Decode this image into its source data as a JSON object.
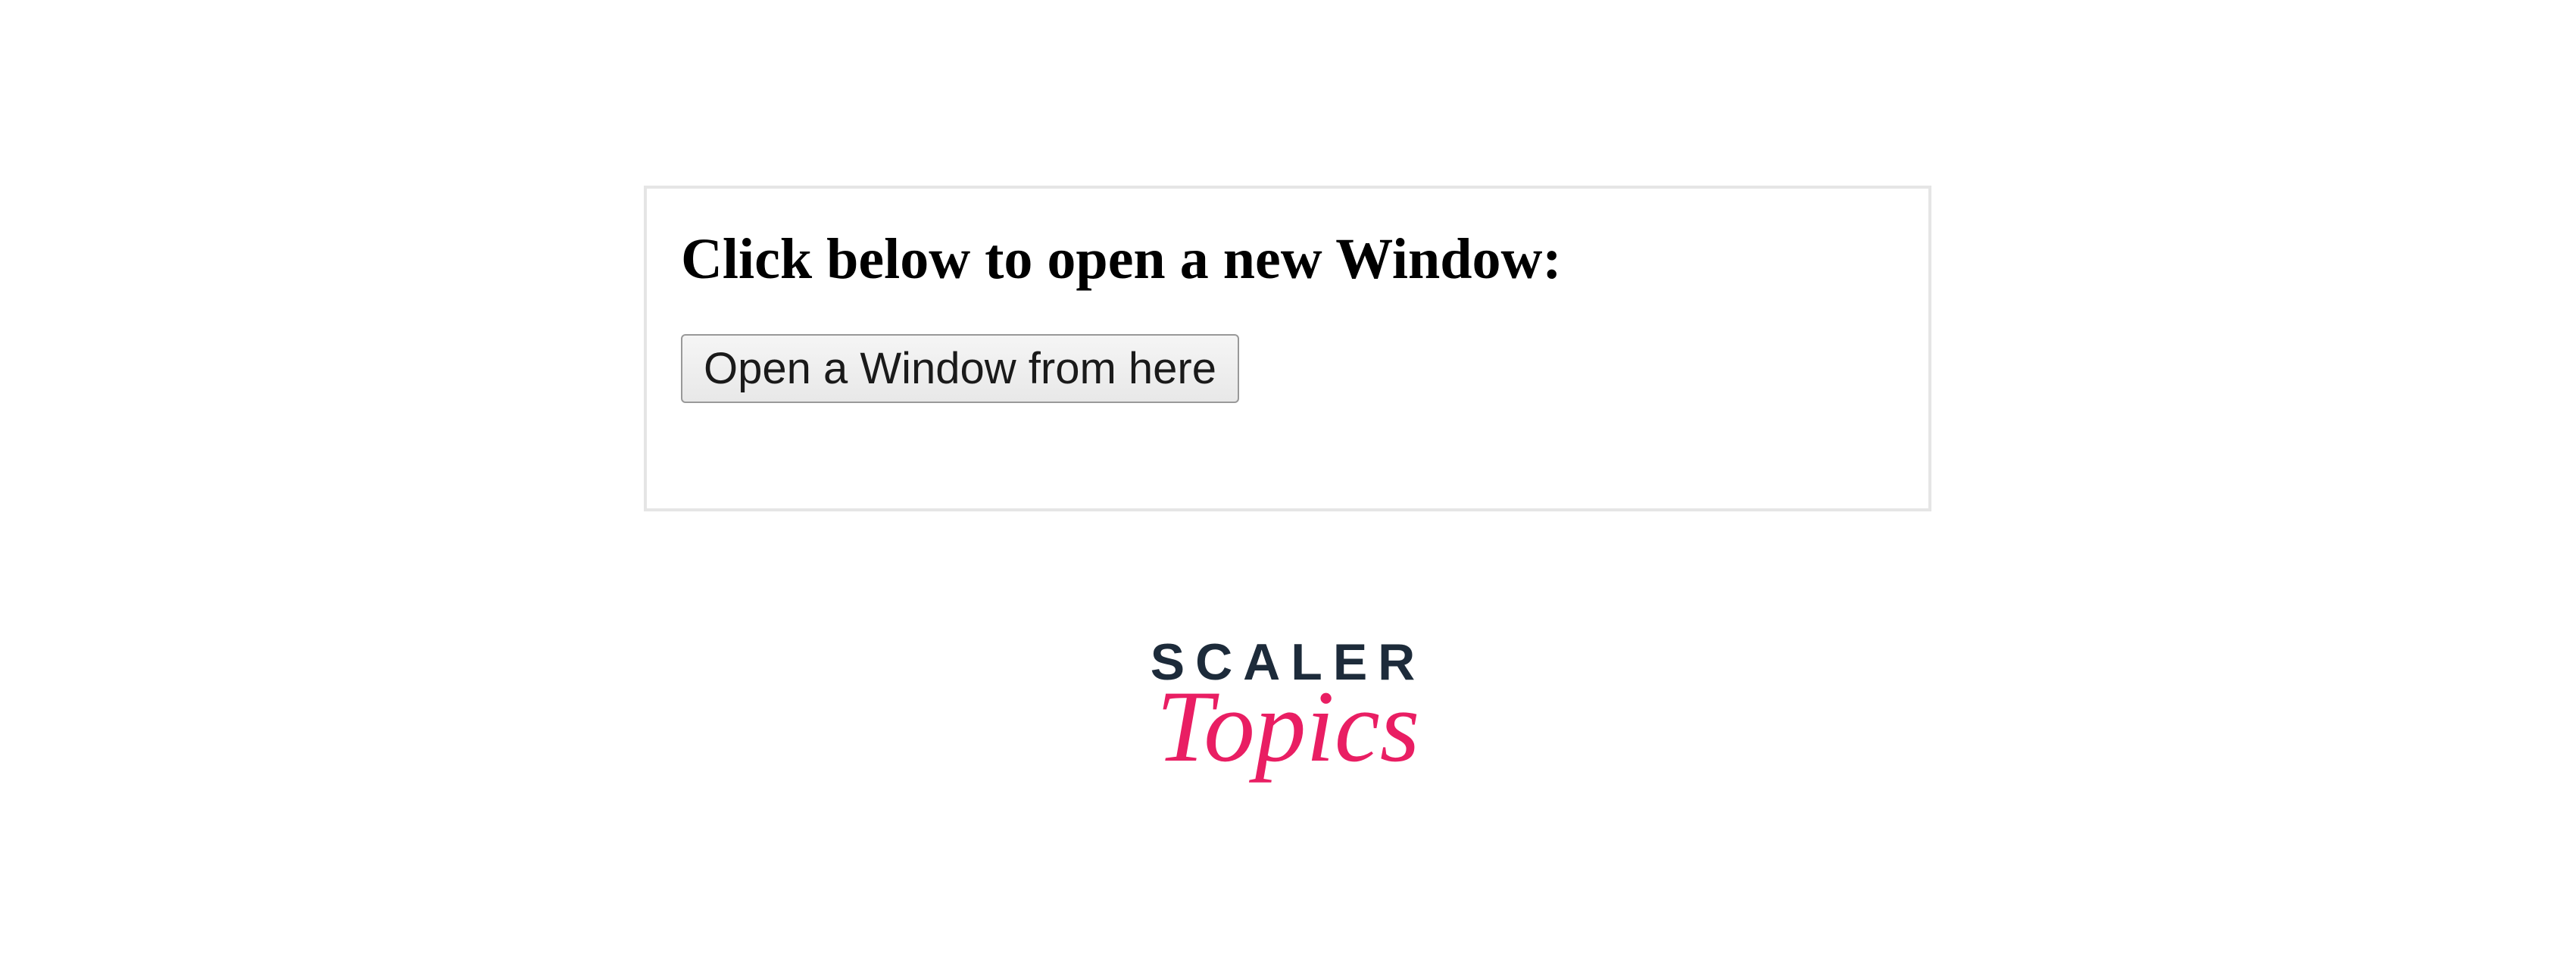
{
  "content": {
    "heading": "Click below to open a new Window:",
    "button_label": "Open a Window from here"
  },
  "logo": {
    "line1": "SCALER",
    "line2": "Topics"
  },
  "colors": {
    "logo_primary": "#1d2b3a",
    "logo_accent": "#e91e63",
    "border": "#e5e5e5"
  }
}
